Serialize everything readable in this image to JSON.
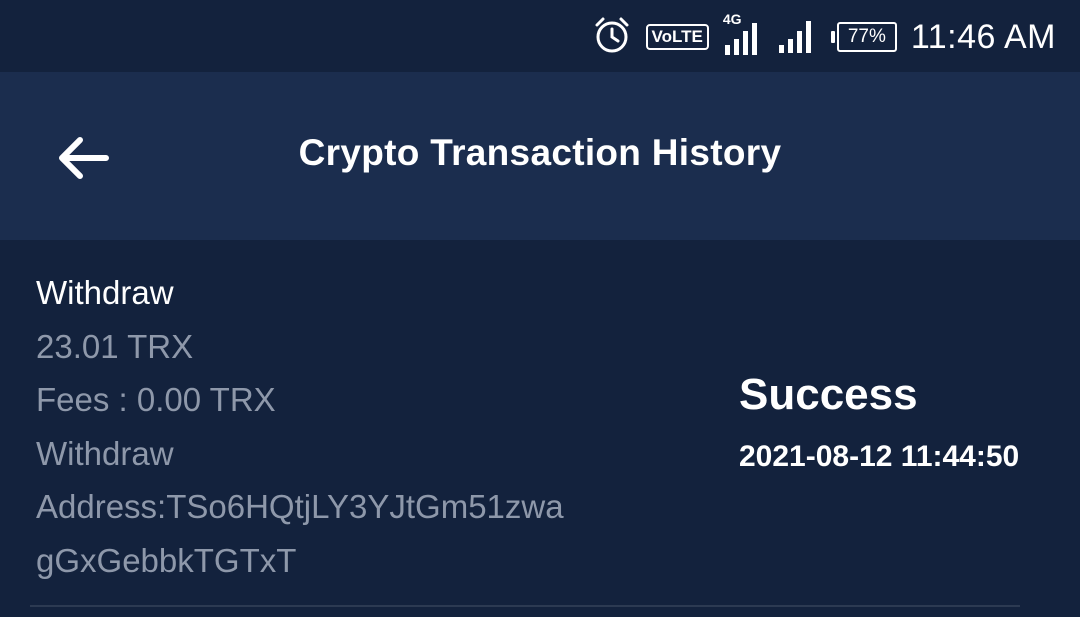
{
  "status_bar": {
    "time": "11:46 AM",
    "battery": "77%",
    "volte": "VoLTE",
    "network": "4G",
    "icons": [
      "alarm-icon",
      "volte-icon",
      "signal-4g-icon",
      "signal-icon",
      "battery-icon"
    ]
  },
  "header": {
    "title": "Crypto Transaction History",
    "back_icon": "arrow-left-icon"
  },
  "transactions": [
    {
      "type": "Withdraw",
      "amount": "23.01 TRX",
      "fees": "Fees : 0.00 TRX",
      "kind": "Withdraw",
      "address": "Address:TSo6HQtjLY3YJtGm51zwagGxGebbkTGTxT",
      "status": "Success",
      "datetime": "2021-08-12 11:44:50"
    }
  ],
  "colors": {
    "background": "#13223d",
    "app_bar": "#1b2d4e",
    "muted_text": "#8e98aa"
  }
}
